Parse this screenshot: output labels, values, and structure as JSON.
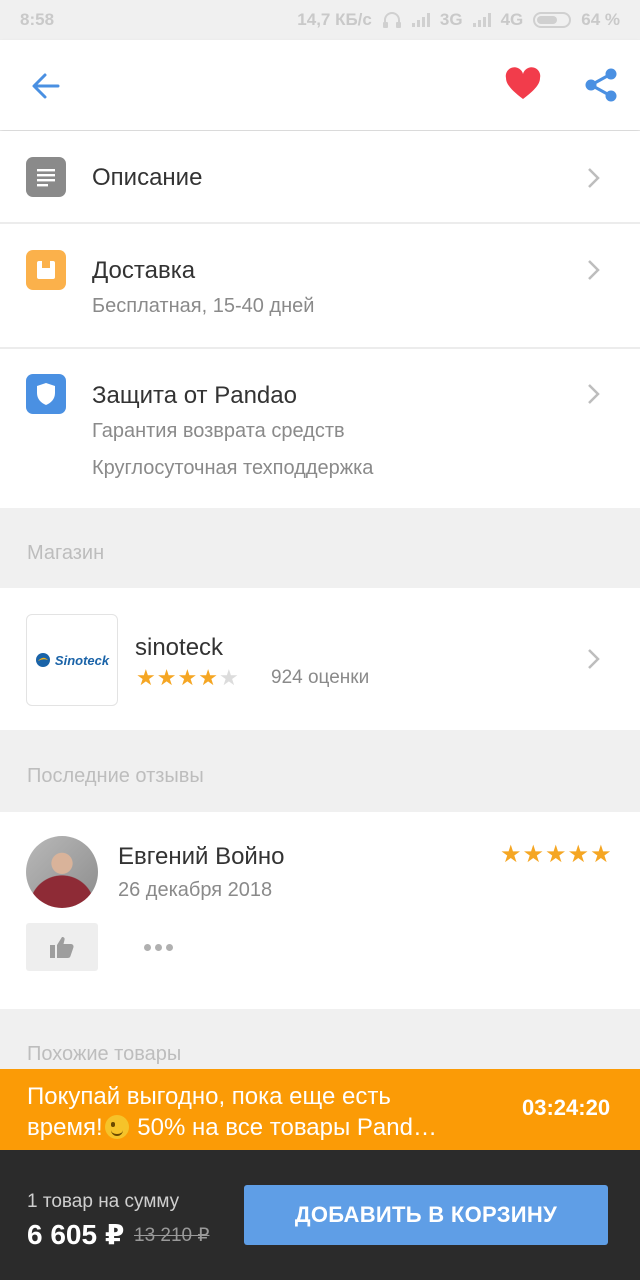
{
  "status_bar": {
    "time": "8:58",
    "speed": "14,7 КБ/с",
    "network1": "3G",
    "network2": "4G",
    "battery": "64 %"
  },
  "header": {
    "back_icon": "arrow-left-icon",
    "favorite_icon": "heart-icon",
    "share_icon": "share-icon",
    "accent": "#4a90e2",
    "favorite_color": "#f23c4b"
  },
  "info_rows": [
    {
      "icon": "document-icon",
      "icon_color": "#8a8a8a",
      "title": "Описание"
    },
    {
      "icon": "box-icon",
      "icon_color": "#fbb14b",
      "title": "Доставка",
      "subtitle": "Бесплатная, 15-40 дней"
    },
    {
      "icon": "shield-icon",
      "icon_color": "#4a90e2",
      "title": "Защита от Pandao",
      "lines": [
        "Гарантия возврата средств",
        "Круглосуточная техподдержка"
      ]
    }
  ],
  "store_section": {
    "label": "Магазин",
    "logo_text": "Sinoteck",
    "name": "sinoteck",
    "rating": 4,
    "rating_max": 5,
    "ratings_count": "924 оценки"
  },
  "reviews_section": {
    "label": "Последние отзывы",
    "review": {
      "author": "Евгений Войно",
      "date": "26 декабря 2018",
      "rating": 5
    }
  },
  "similar_section": {
    "label": "Похожие товары"
  },
  "promo": {
    "line1": "Покупай выгодно, пока еще есть",
    "line2_before": "время!",
    "line2_after": " 50% на все товары Pand…",
    "timer": "03:24:20",
    "color": "#fb9b06"
  },
  "bottom_bar": {
    "summary_label": "1 товар на сумму",
    "price": "6 605 ₽",
    "old_price": "13 210 ₽",
    "cart_button": "ДОБАВИТЬ В КОРЗИНУ",
    "button_color": "#5f9ee6"
  }
}
